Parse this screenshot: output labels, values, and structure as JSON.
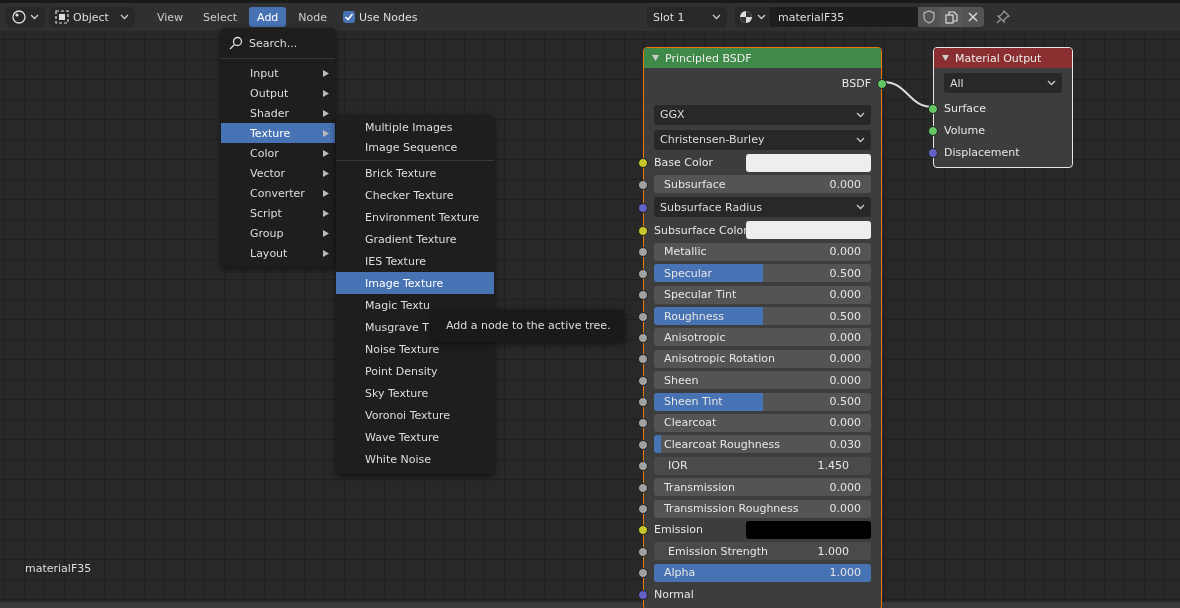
{
  "header": {
    "mode_dropdown": {
      "value": "Object"
    },
    "menus": [
      {
        "label": "View",
        "selected": false
      },
      {
        "label": "Select",
        "selected": false
      },
      {
        "label": "Add",
        "selected": true
      },
      {
        "label": "Node",
        "selected": false
      }
    ],
    "use_nodes": {
      "label": "Use Nodes",
      "checked": true
    },
    "slot_dropdown": {
      "value": "Slot 1"
    },
    "material_field": {
      "value": "materialF35"
    }
  },
  "add_menu": {
    "search": {
      "label": "Search..."
    },
    "items": [
      {
        "label": "Input",
        "selected": false
      },
      {
        "label": "Output",
        "selected": false
      },
      {
        "label": "Shader",
        "selected": false
      },
      {
        "label": "Texture",
        "selected": true
      },
      {
        "label": "Color",
        "selected": false
      },
      {
        "label": "Vector",
        "selected": false
      },
      {
        "label": "Converter",
        "selected": false
      },
      {
        "label": "Script",
        "selected": false
      },
      {
        "label": "Group",
        "selected": false
      },
      {
        "label": "Layout",
        "selected": false
      }
    ]
  },
  "texture_menu": {
    "groups": [
      [
        {
          "label": "Multiple Images",
          "selected": false
        },
        {
          "label": "Image Sequence",
          "selected": false
        }
      ],
      [
        {
          "label": "Brick Texture",
          "selected": false
        },
        {
          "label": "Checker Texture",
          "selected": false
        },
        {
          "label": "Environment Texture",
          "selected": false
        },
        {
          "label": "Gradient Texture",
          "selected": false
        },
        {
          "label": "IES Texture",
          "selected": false
        },
        {
          "label": "Image Texture",
          "selected": true
        },
        {
          "label": "Magic Textu",
          "selected": false
        },
        {
          "label": "Musgrave T",
          "selected": false
        },
        {
          "label": "Noise Texture",
          "selected": false
        },
        {
          "label": "Point Density",
          "selected": false
        },
        {
          "label": "Sky Texture",
          "selected": false
        },
        {
          "label": "Voronoi Texture",
          "selected": false
        },
        {
          "label": "Wave Texture",
          "selected": false
        },
        {
          "label": "White Noise",
          "selected": false
        }
      ]
    ]
  },
  "tooltip": {
    "text": "Add a node to the active tree."
  },
  "canvas_label": "materialF35",
  "nodes": [
    {
      "title": "Principled BSDF",
      "kind": "shader",
      "active": true,
      "rows": [
        {
          "kind": "output",
          "label": "BSDF",
          "socket": {
            "color": "#63c763"
          }
        },
        {
          "kind": "dropdown",
          "value": "GGX"
        },
        {
          "kind": "dropdown",
          "value": "Christensen-Burley"
        },
        {
          "kind": "color",
          "label": "Base Color",
          "socket": {
            "color": "#c7c729"
          },
          "color": "#eeeeee"
        },
        {
          "kind": "slider",
          "label": "Subsurface",
          "value": "0.000",
          "level": 0,
          "socket": {
            "color": "#a1a1a1"
          }
        },
        {
          "kind": "dropdown",
          "value": "Subsurface Radius",
          "socket": {
            "color": "#6363c7"
          }
        },
        {
          "kind": "color",
          "label": "Subsurface Color",
          "socket": {
            "color": "#c7c729"
          },
          "color": "#eeeeee"
        },
        {
          "kind": "slider",
          "label": "Metallic",
          "value": "0.000",
          "level": 0,
          "socket": {
            "color": "#a1a1a1"
          }
        },
        {
          "kind": "slider",
          "label": "Specular",
          "value": "0.500",
          "level": 0.5,
          "socket": {
            "color": "#a1a1a1"
          }
        },
        {
          "kind": "slider",
          "label": "Specular Tint",
          "value": "0.000",
          "level": 0,
          "socket": {
            "color": "#a1a1a1"
          }
        },
        {
          "kind": "slider",
          "label": "Roughness",
          "value": "0.500",
          "level": 0.5,
          "socket": {
            "color": "#a1a1a1"
          }
        },
        {
          "kind": "slider",
          "label": "Anisotropic",
          "value": "0.000",
          "level": 0,
          "socket": {
            "color": "#a1a1a1"
          }
        },
        {
          "kind": "slider",
          "label": "Anisotropic Rotation",
          "value": "0.000",
          "level": 0,
          "socket": {
            "color": "#a1a1a1"
          }
        },
        {
          "kind": "slider",
          "label": "Sheen",
          "value": "0.000",
          "level": 0,
          "socket": {
            "color": "#a1a1a1"
          }
        },
        {
          "kind": "slider",
          "label": "Sheen Tint",
          "value": "0.500",
          "level": 0.5,
          "socket": {
            "color": "#a1a1a1"
          }
        },
        {
          "kind": "slider",
          "label": "Clearcoat",
          "value": "0.000",
          "level": 0,
          "socket": {
            "color": "#a1a1a1"
          }
        },
        {
          "kind": "slider",
          "label": "Clearcoat Roughness",
          "value": "0.030",
          "level": 0.03,
          "socket": {
            "color": "#a1a1a1"
          }
        },
        {
          "kind": "number",
          "label": "IOR",
          "value": "1.450",
          "socket": {
            "color": "#a1a1a1"
          }
        },
        {
          "kind": "slider",
          "label": "Transmission",
          "value": "0.000",
          "level": 0,
          "socket": {
            "color": "#a1a1a1"
          }
        },
        {
          "kind": "slider",
          "label": "Transmission Roughness",
          "value": "0.000",
          "level": 0,
          "socket": {
            "color": "#a1a1a1"
          }
        },
        {
          "kind": "color",
          "label": "Emission",
          "socket": {
            "color": "#c7c729"
          },
          "color": "#000000"
        },
        {
          "kind": "number",
          "label": "Emission Strength",
          "value": "1.000",
          "socket": {
            "color": "#a1a1a1"
          }
        },
        {
          "kind": "slider",
          "label": "Alpha",
          "value": "1.000",
          "level": 1,
          "socket": {
            "color": "#a1a1a1"
          }
        },
        {
          "kind": "input",
          "label": "Normal",
          "socket": {
            "color": "#6363c7"
          }
        }
      ]
    },
    {
      "title": "Material Output",
      "kind": "output",
      "active": false,
      "rows": [
        {
          "kind": "dropdown",
          "value": "All"
        },
        {
          "kind": "input",
          "label": "Surface",
          "socket": {
            "color": "#63c763"
          }
        },
        {
          "kind": "input",
          "label": "Volume",
          "socket": {
            "color": "#63c763"
          }
        },
        {
          "kind": "input",
          "label": "Displacement",
          "socket": {
            "color": "#6363c7"
          }
        }
      ]
    }
  ]
}
